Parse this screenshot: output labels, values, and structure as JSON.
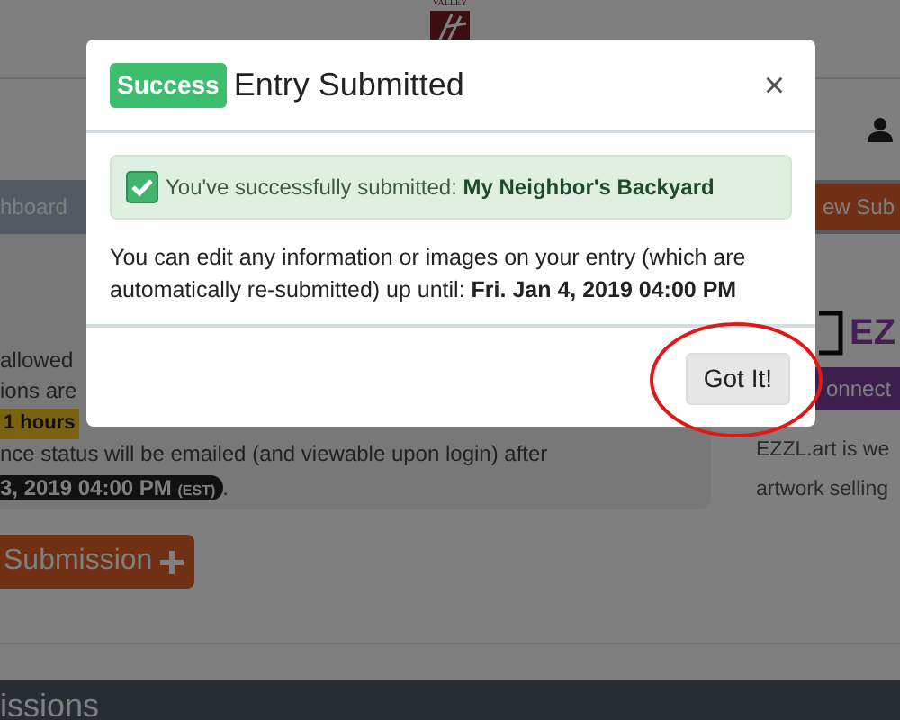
{
  "page": {
    "logo_text": "VALLEY",
    "dashboard_tab": "hboard",
    "new_button": "ew Sub",
    "notice_lines": [
      "allowed",
      "ions are"
    ],
    "time_left_badge": "1 hours",
    "status_line": "nce status will be emailed (and viewable upon login) after",
    "deadline_badge": "3, 2019 04:00 PM",
    "deadline_zone": "(EST)",
    "deadline_end": ".",
    "add_button": "Submission",
    "partner_logo": "EZ",
    "partner_button": "onnect",
    "partner_lines": [
      "EZZL.art is we",
      "artwork selling"
    ],
    "section_title": "issions"
  },
  "modal": {
    "badge": "Success",
    "title": "Entry Submitted",
    "close": "×",
    "alert": "You've successfully submitted: **My Neighbor's Backyard**",
    "alert_checked": true,
    "message": "You can edit any information or images on your entry (which are automatically re-submitted) up until: **Fri. Jan 4, 2019 04:00 PM**",
    "button": "Got It!",
    "button_circled": true
  }
}
